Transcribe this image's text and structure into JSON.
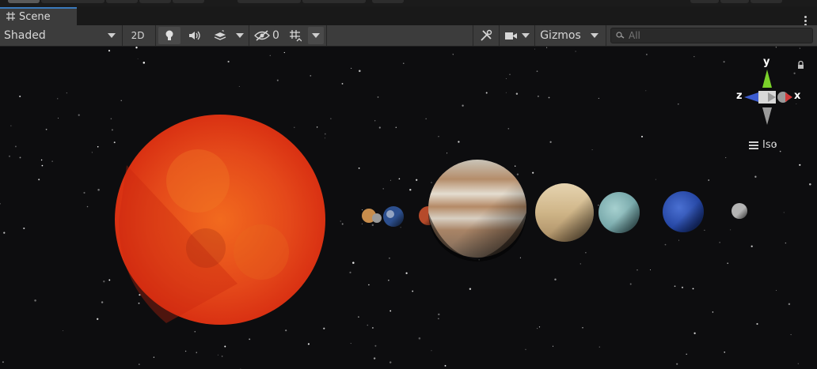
{
  "window": {
    "tab_label": "Scene"
  },
  "toolbar": {
    "shading_mode": "Shaded",
    "mode_2d_label": "2D",
    "hidden_count": "0",
    "gizmos_label": "Gizmos"
  },
  "search": {
    "placeholder": "All"
  },
  "orientation_gizmo": {
    "y_label": "y",
    "x_label": "x",
    "z_label": "z",
    "projection_label": "Iso"
  },
  "colors": {
    "sun": "#e8401a",
    "gizmo_y": "#7ad12a",
    "gizmo_x": "#d13a3a",
    "gizmo_z": "#3c5ccf",
    "tab_accent": "#3a79bb"
  },
  "scene": {
    "bodies": [
      "sun",
      "mercury",
      "venus",
      "earth",
      "mars",
      "jupiter",
      "saturn",
      "uranus",
      "neptune",
      "pluto"
    ]
  }
}
